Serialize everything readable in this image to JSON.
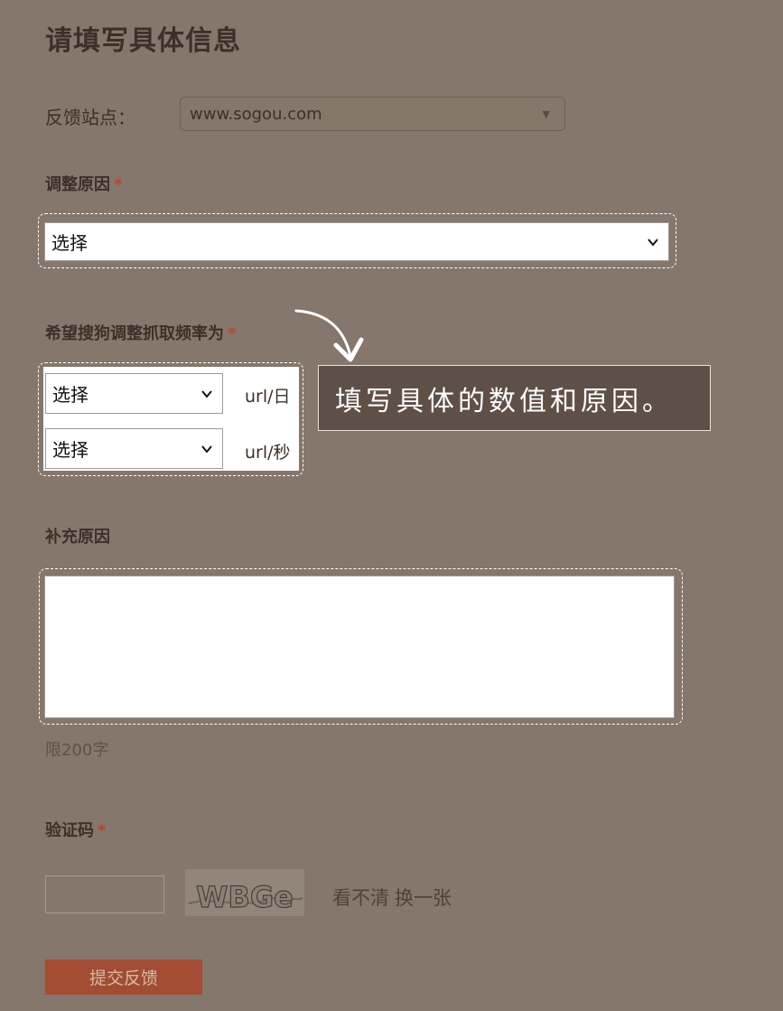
{
  "page_title": "请填写具体信息",
  "site_field": {
    "label": "反馈站点：",
    "value": "www.sogou.com"
  },
  "reason_field": {
    "label": "调整原因",
    "required_mark": "*",
    "selected": "选择"
  },
  "freq_field": {
    "label": "希望搜狗调整抓取频率为",
    "required_mark": "*",
    "rows": [
      {
        "selected": "选择",
        "unit": "url/日"
      },
      {
        "selected": "选择",
        "unit": "url/秒"
      }
    ]
  },
  "tip": {
    "text": "填写具体的数值和原因。"
  },
  "extra_field": {
    "label": "补充原因",
    "value": "",
    "limit_text": "限200字"
  },
  "captcha_field": {
    "label": "验证码",
    "required_mark": "*",
    "value": "",
    "image_text": "WBGe",
    "unclear_link": "看不清",
    "refresh_link": "换一张"
  },
  "submit_label": "提交反馈",
  "colors": {
    "background": "#85776b",
    "heading": "#3e3028",
    "required": "#b24a2e",
    "tip_bg": "#5f5047",
    "submit_bg": "#a24c34"
  }
}
